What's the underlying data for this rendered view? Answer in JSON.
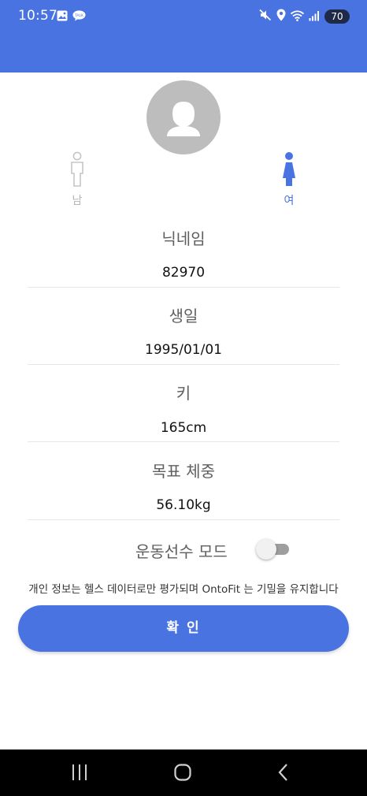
{
  "status_bar": {
    "time": "10:57",
    "battery": "70",
    "left_icons": [
      "image-icon",
      "talk-icon"
    ],
    "right_icons": [
      "mute-icon",
      "location-icon",
      "wifi-icon",
      "signal-icon"
    ]
  },
  "profile": {
    "avatar_icon": "female-avatar-icon",
    "gender": {
      "male_label": "남",
      "female_label": "여",
      "selected": "여",
      "male_color": "#c6c6c6",
      "female_color": "#4a73e2"
    }
  },
  "fields": {
    "nickname": {
      "label": "닉네임",
      "value": "82970"
    },
    "birthday": {
      "label": "생일",
      "value": "1995/01/01"
    },
    "height": {
      "label": "키",
      "value": "165cm"
    },
    "target_weight": {
      "label": "목표 체중",
      "value": "56.10kg"
    }
  },
  "athlete_mode": {
    "label": "운동선수 모드",
    "enabled": false
  },
  "notice": "개인 정보는 헬스 데이터로만 평가되며 OntoFit 는 기밀을 유지합니다",
  "confirm_label": "확 인",
  "colors": {
    "accent": "#4a73e2",
    "nav_bar": "#000000"
  },
  "nav_bar": {
    "icons": [
      "recent-apps-icon",
      "home-icon",
      "back-icon"
    ]
  }
}
